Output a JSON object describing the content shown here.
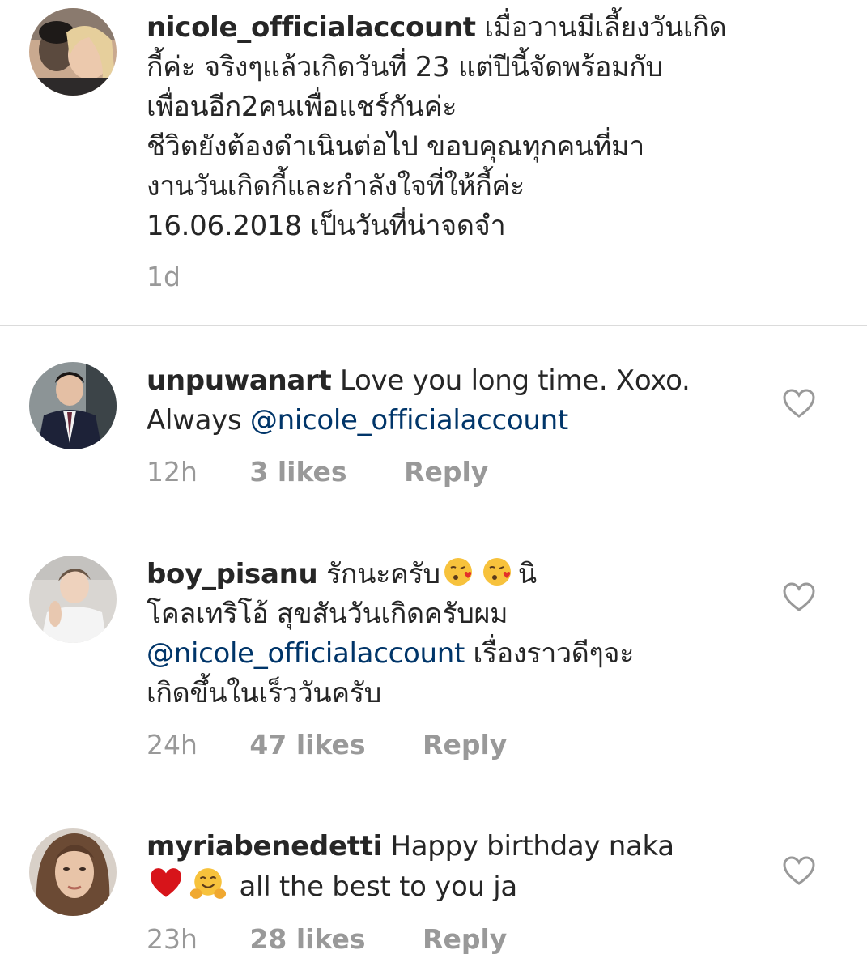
{
  "caption": {
    "username": "nicole_officialaccount",
    "text_line1": " เมื่อวานมีเลี้ยงวันเกิด",
    "text_rest": "กี้ค่ะ จริงๆแล้วเกิดวันที่ 23 แต่ปีนี้จัดพร้อมกับ\nเพื่อนอีก2คนเพื่อแชร์กันค่ะ\nชีวิตยังต้องดำเนินต่อไป ขอบคุณทุกคนที่มา\nงานวันเกิดกี้และกำลังใจที่ให้กี้ค่ะ\n16.06.2018  เป็นวันที่น่าจดจำ",
    "time": "1d"
  },
  "comments": [
    {
      "username": "unpuwanart",
      "text_before": " Love you long time.  Xoxo.\nAlways ",
      "mention": "@nicole_officialaccount",
      "text_after": "",
      "time": "12h",
      "likes": "3 likes",
      "reply": "Reply"
    },
    {
      "username": "boy_pisanu",
      "text_a": " รักนะครับ",
      "text_b": "นิ\nโคลเทริโอ้ สุขสันวันเกิดครับผม\n",
      "mention": "@nicole_officialaccount",
      "text_after": " เรื่องราวดีๆจะ\nเกิดขึ้นในเร็ววันครับ",
      "time": "24h",
      "likes": "47 likes",
      "reply": "Reply"
    },
    {
      "username": "myriabenedetti",
      "text_before": " Happy birthday naka",
      "text_after": " all the best to you ja",
      "time": "23h",
      "likes": "28 likes",
      "reply": "Reply"
    }
  ],
  "icons": {
    "like": "heart-outline-icon",
    "kiss": "face-blowing-kiss-emoji",
    "red_heart": "red-heart-emoji",
    "hug": "hugging-face-emoji"
  },
  "colors": {
    "text": "#262626",
    "meta": "#999999",
    "mention": "#003569",
    "divider": "#dbdbdb"
  }
}
